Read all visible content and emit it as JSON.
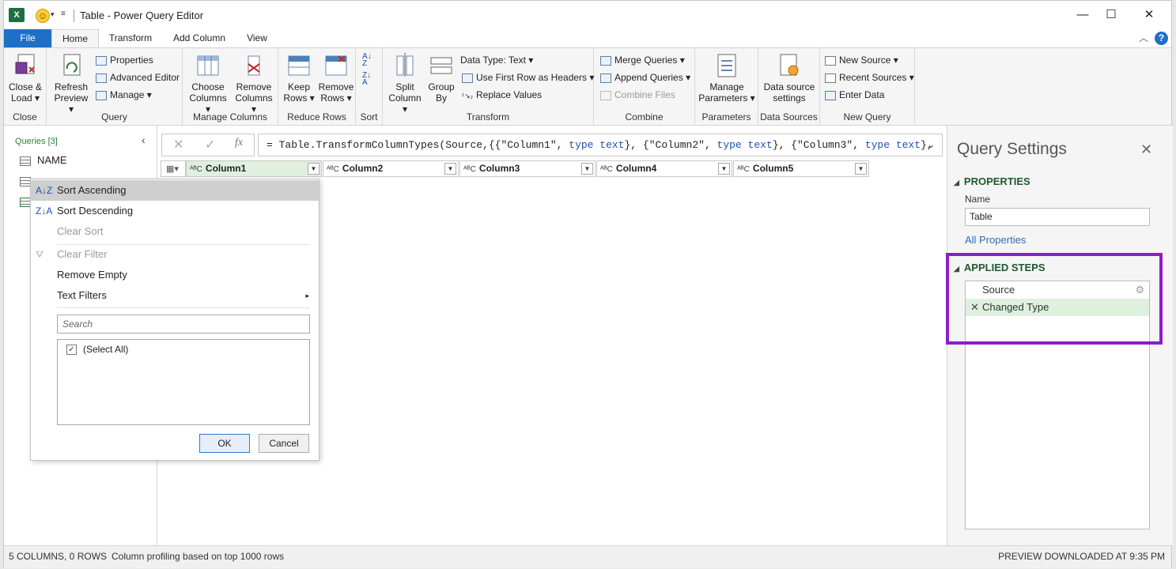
{
  "window": {
    "title": "Table - Power Query Editor",
    "minimize": "—",
    "maximize": "☐",
    "close": "✕",
    "app_icon": "X"
  },
  "tabs": [
    "File",
    "Home",
    "Transform",
    "Add Column",
    "View"
  ],
  "ribbon": {
    "close": {
      "btn": "Close &",
      "btn2": "Load",
      "label": "Close"
    },
    "query": {
      "refresh": "Refresh",
      "refresh2": "Preview",
      "properties": "Properties",
      "advanced_editor": "Advanced Editor",
      "manage": "Manage",
      "label": "Query"
    },
    "manage_columns": {
      "choose": "Choose",
      "choose2": "Columns",
      "remove": "Remove",
      "remove2": "Columns",
      "label": "Manage Columns"
    },
    "reduce_rows": {
      "keep": "Keep",
      "keep2": "Rows",
      "remove": "Remove",
      "remove2": "Rows",
      "label": "Reduce Rows"
    },
    "sort": {
      "label": "Sort"
    },
    "transform": {
      "split": "Split",
      "split2": "Column",
      "group": "Group",
      "group2": "By",
      "data_type": "Data Type: Text",
      "first_row": "Use First Row as Headers",
      "replace": "Replace Values",
      "label": "Transform"
    },
    "combine": {
      "merge": "Merge Queries",
      "append": "Append Queries",
      "combine_files": "Combine Files",
      "label": "Combine"
    },
    "parameters": {
      "manage": "Manage",
      "manage2": "Parameters",
      "label": "Parameters"
    },
    "data_sources": {
      "btn": "Data source",
      "btn2": "settings",
      "label": "Data Sources"
    },
    "new_query": {
      "new_source": "New Source",
      "recent": "Recent Sources",
      "enter": "Enter Data",
      "label": "New Query"
    }
  },
  "queries": {
    "header": "Queries [3]",
    "items": [
      "NAME"
    ]
  },
  "formula": {
    "fx": "fx",
    "prefix": "= Table.TransformColumnTypes(Source,{{",
    "c1": "\"Column1\"",
    "c2": "\"Column2\"",
    "c3": "\"Column3\"",
    "type_text": "type text"
  },
  "columns": [
    "Column1",
    "Column2",
    "Column3",
    "Column4",
    "Column5"
  ],
  "menu": {
    "sort_asc": "Sort Ascending",
    "sort_desc": "Sort Descending",
    "clear_sort": "Clear Sort",
    "clear_filter": "Clear Filter",
    "remove_empty": "Remove Empty",
    "text_filters": "Text Filters",
    "search_placeholder": "Search",
    "select_all": "(Select All)",
    "ok": "OK",
    "cancel": "Cancel"
  },
  "query_settings": {
    "title": "Query Settings",
    "properties": "PROPERTIES",
    "name_label": "Name",
    "name_value": "Table",
    "all_properties": "All Properties",
    "applied_steps": "APPLIED STEPS",
    "steps": [
      "Source",
      "Changed Type"
    ]
  },
  "status": {
    "left": "5 COLUMNS, 0 ROWS",
    "profiling": "Column profiling based on top 1000 rows",
    "right": "PREVIEW DOWNLOADED AT 9:35 PM"
  },
  "highlight_color": "#8b1fc8"
}
